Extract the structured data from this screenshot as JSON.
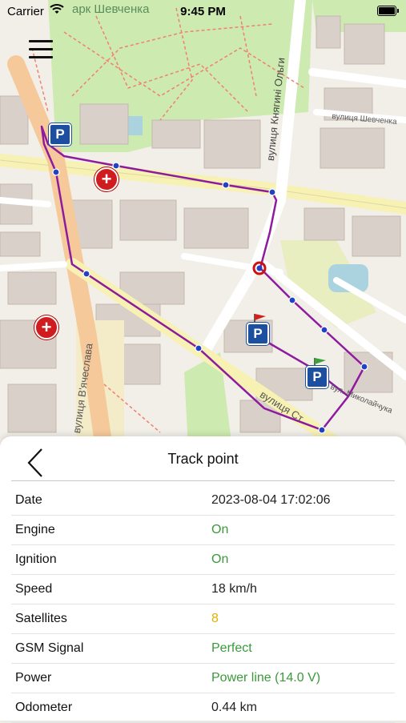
{
  "status_bar": {
    "carrier": "Carrier",
    "time": "9:45 PM"
  },
  "map": {
    "park_label": "арк Шевченка",
    "streets": [
      "вулиця Княгині Ольги",
      "вулиця В'ячеслава",
      "вулиця Ст",
      "вулиця Шевченка",
      "вул. Миколайчука"
    ],
    "route_color": "#8e1b9e"
  },
  "sheet": {
    "title": "Track point",
    "rows": [
      {
        "label": "Date",
        "value": "2023-08-04 17:02:06",
        "color": "#222222"
      },
      {
        "label": "Engine",
        "value": "On",
        "color": "#3a9a3a"
      },
      {
        "label": "Ignition",
        "value": "On",
        "color": "#3a9a3a"
      },
      {
        "label": "Speed",
        "value": "18 km/h",
        "color": "#222222"
      },
      {
        "label": "Satellites",
        "value": "8",
        "color": "#e0b000"
      },
      {
        "label": "GSM Signal",
        "value": "Perfect",
        "color": "#3a9a3a"
      },
      {
        "label": "Power",
        "value": "Power line (14.0 V)",
        "color": "#3a9a3a"
      },
      {
        "label": "Odometer",
        "value": "0.44 km",
        "color": "#222222"
      }
    ]
  }
}
